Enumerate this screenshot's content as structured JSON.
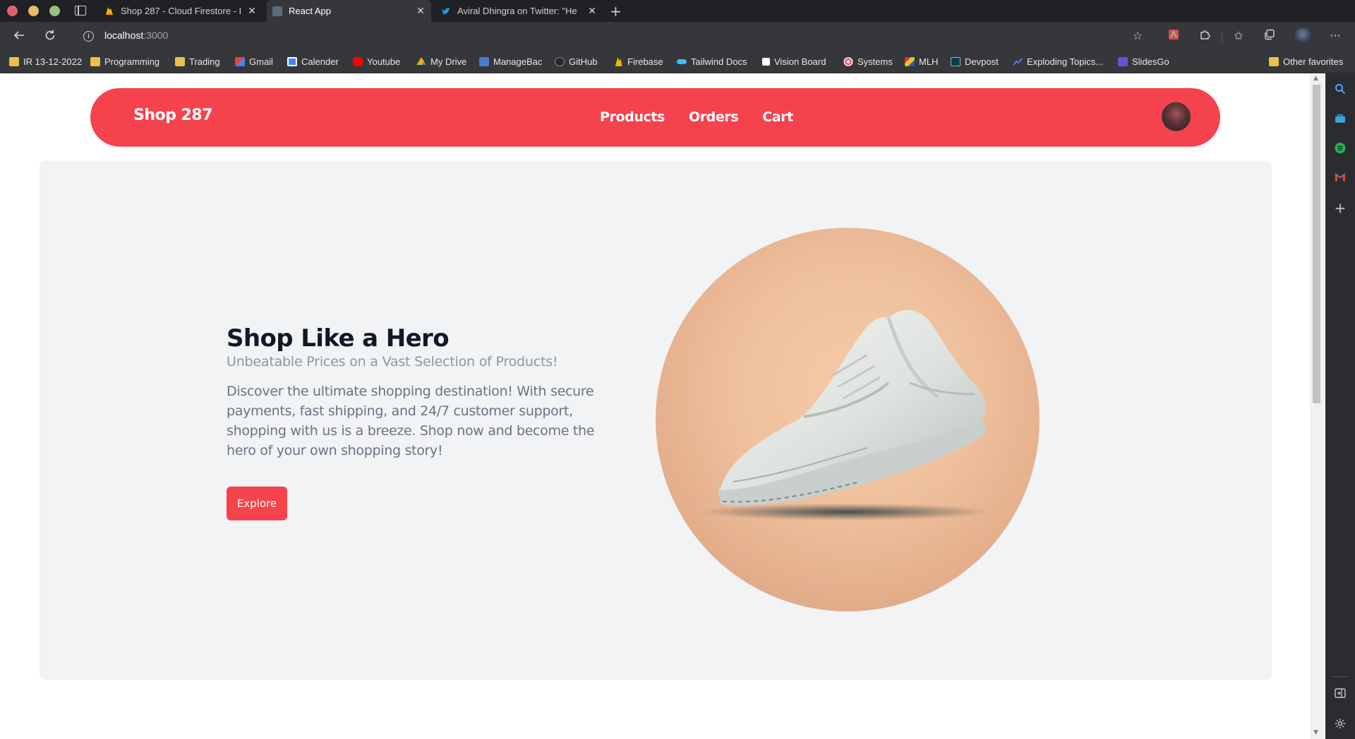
{
  "browser": {
    "tabs": [
      {
        "title": "Shop 287 - Cloud Firestore - F",
        "active": false,
        "icon": "firebase-icon"
      },
      {
        "title": "React App",
        "active": true,
        "icon": "react-icon"
      },
      {
        "title": "Aviral Dhingra on Twitter: \"He",
        "active": false,
        "icon": "twitter-icon"
      }
    ],
    "url": {
      "host": "localhost",
      "port": ":3000"
    },
    "bookmarks": [
      {
        "label": "IR 13-12-2022",
        "icon": "folder-icon"
      },
      {
        "label": "Programming",
        "icon": "folder-icon"
      },
      {
        "label": "Trading",
        "icon": "folder-icon"
      },
      {
        "label": "Gmail",
        "icon": "gmail-icon"
      },
      {
        "label": "Calender",
        "icon": "calendar-icon"
      },
      {
        "label": "Youtube",
        "icon": "youtube-icon"
      },
      {
        "label": "My Drive",
        "icon": "drive-icon"
      },
      {
        "label": "ManageBac",
        "icon": "managebac-icon"
      },
      {
        "label": "GitHub",
        "icon": "github-icon"
      },
      {
        "label": "Firebase",
        "icon": "firebase-icon"
      },
      {
        "label": "Tailwind Docs",
        "icon": "tailwind-icon"
      },
      {
        "label": "Vision Board",
        "icon": "notion-icon"
      },
      {
        "label": "Systems",
        "icon": "target-icon"
      },
      {
        "label": "MLH",
        "icon": "mlh-icon"
      },
      {
        "label": "Devpost",
        "icon": "devpost-icon"
      },
      {
        "label": "Exploding Topics...",
        "icon": "trend-icon"
      },
      {
        "label": "SlidesGo",
        "icon": "slidesgo-icon"
      }
    ],
    "other_favorites": "Other favorites"
  },
  "navbar": {
    "brand": "Shop 287",
    "links": [
      "Products",
      "Orders",
      "Cart"
    ]
  },
  "hero": {
    "title": "Shop Like a Hero",
    "subtitle": "Unbeatable Prices on a Vast Selection of Products!",
    "description": "Discover the ultimate shopping destination! With secure payments, fast shipping, and 24/7 customer support, shopping with us is a breeze. Shop now and become the hero of your own shopping story!",
    "cta": "Explore",
    "image": "white-sneaker-image"
  },
  "colors": {
    "brand": "#f5434d",
    "hero_bg": "#f2f3f5",
    "title": "#111827",
    "subtitle": "#8a97aa",
    "body_text": "#6b7280"
  }
}
